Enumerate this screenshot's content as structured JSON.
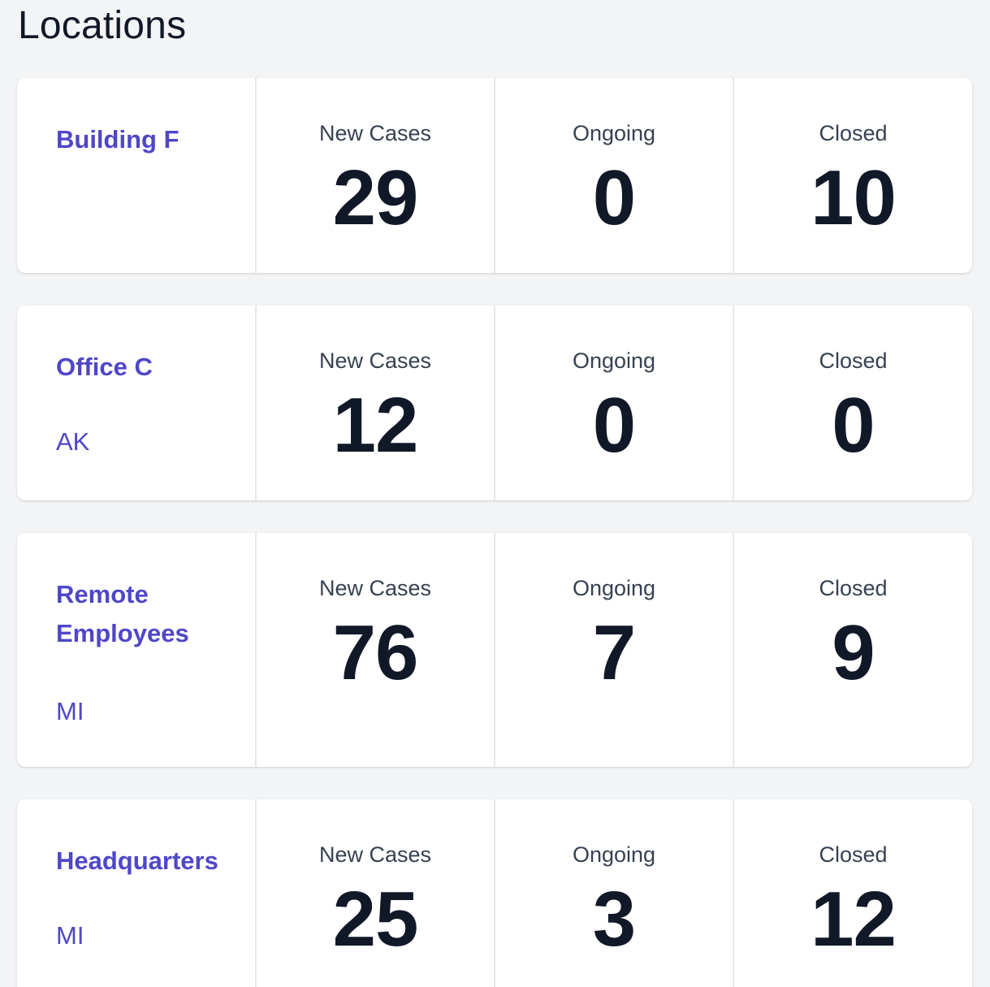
{
  "page": {
    "title": "Locations"
  },
  "columns": {
    "new_cases": "New Cases",
    "ongoing": "Ongoing",
    "closed": "Closed"
  },
  "locations": [
    {
      "name": "Building F",
      "state": "",
      "new_cases": "29",
      "ongoing": "0",
      "closed": "10"
    },
    {
      "name": "Office C",
      "state": "AK",
      "new_cases": "12",
      "ongoing": "0",
      "closed": "0"
    },
    {
      "name": "Remote Employees",
      "state": "MI",
      "new_cases": "76",
      "ongoing": "7",
      "closed": "9"
    },
    {
      "name": "Headquarters",
      "state": "MI",
      "new_cases": "25",
      "ongoing": "3",
      "closed": "12"
    }
  ],
  "colors": {
    "background": "#f3f4f6",
    "card": "#ffffff",
    "link": "#4f46c8",
    "value_text": "#111827",
    "label_text": "#374151",
    "divider": "#e5e7eb"
  }
}
